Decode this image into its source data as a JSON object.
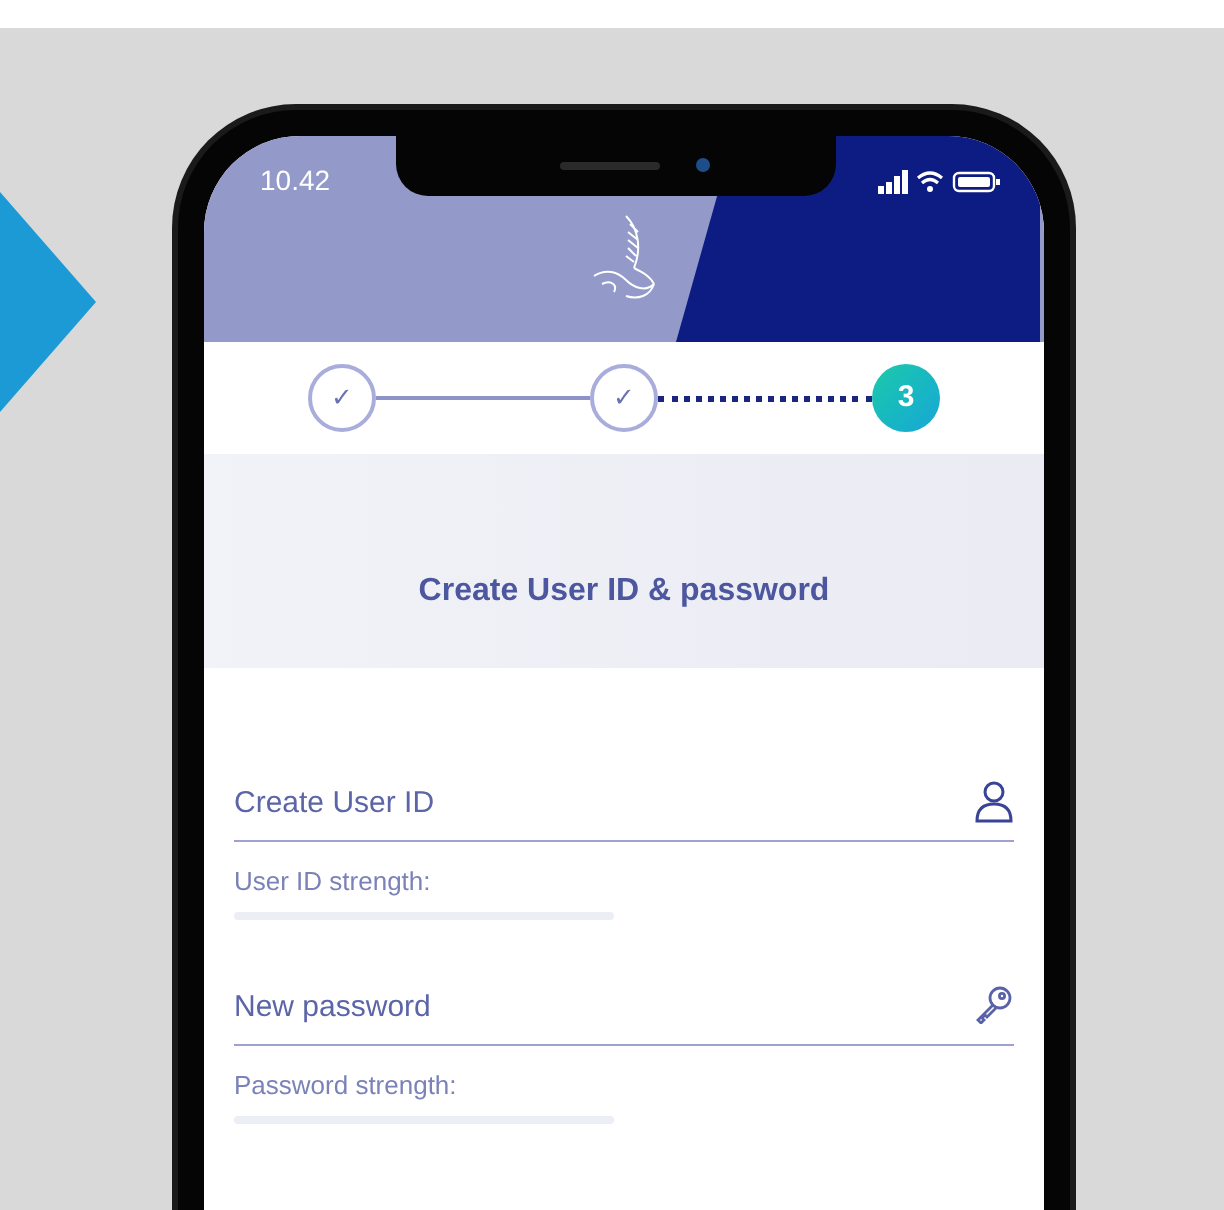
{
  "status_bar": {
    "time": "10.42"
  },
  "steps": [
    {
      "label": "✓",
      "kind": "done"
    },
    {
      "label": "✓",
      "kind": "done"
    },
    {
      "label": "3",
      "kind": "current"
    }
  ],
  "title": "Create User ID & password",
  "fields": [
    {
      "placeholder": "Create User ID",
      "kind": "user",
      "strength_label": "User ID strength:"
    },
    {
      "placeholder": "New password",
      "kind": "password",
      "strength_label": "Password strength:"
    }
  ]
}
